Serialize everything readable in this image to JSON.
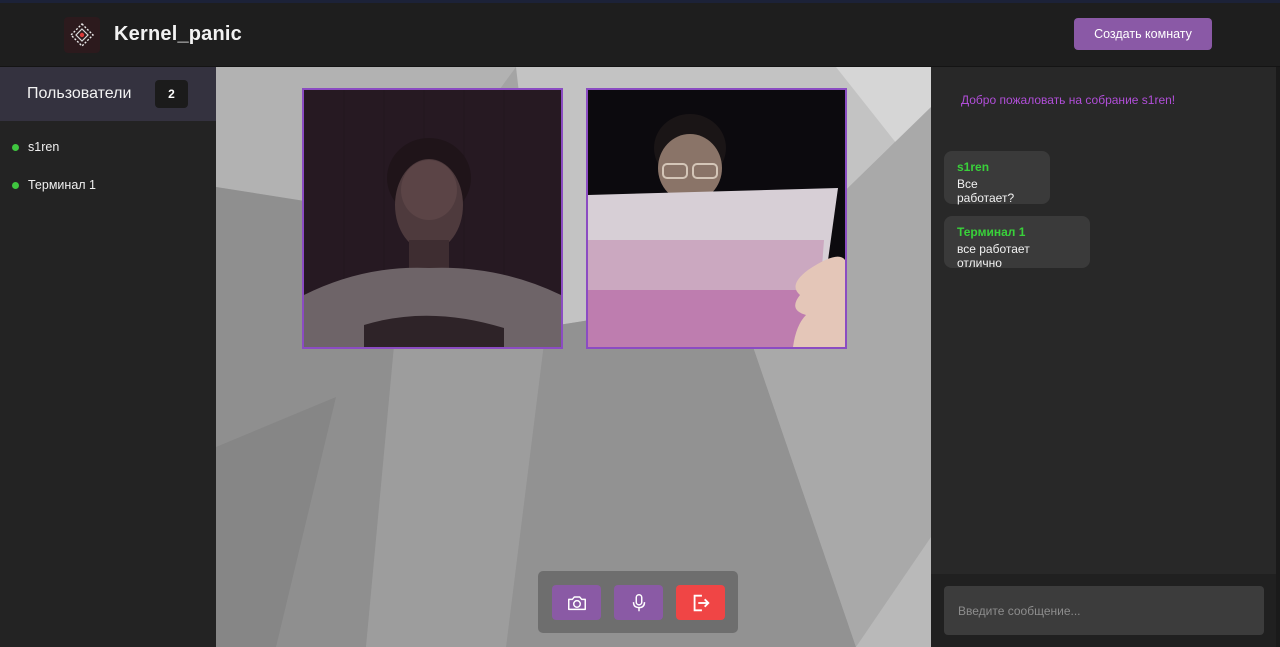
{
  "header": {
    "brand": "Kernel_panic",
    "create_room_label": "Создать комнату",
    "logo_icon": "diamond-logo-icon"
  },
  "sidebar": {
    "title": "Пользователи",
    "count": "2",
    "users": [
      {
        "name": "s1ren",
        "status": "online"
      },
      {
        "name": "Терминал 1",
        "status": "online"
      }
    ]
  },
  "stage": {
    "videos": [
      {
        "participant": "participant-1"
      },
      {
        "participant": "participant-2"
      }
    ],
    "controls": [
      {
        "name": "camera",
        "icon": "camera-icon"
      },
      {
        "name": "microphone",
        "icon": "microphone-icon"
      },
      {
        "name": "leave",
        "icon": "exit-icon"
      }
    ]
  },
  "chat": {
    "welcome": "Добро пожаловать на собрание s1ren!",
    "messages": [
      {
        "author": "s1ren",
        "text": "Все работает?"
      },
      {
        "author": "Терминал 1",
        "text": "все работает отлично"
      }
    ],
    "input_placeholder": "Введите сообщение..."
  },
  "colors": {
    "accent": "#8a59a6",
    "online": "#3fc53f",
    "author": "#39d13a",
    "welcome": "#b14ed9",
    "danger": "#f04545",
    "video_border": "#8b4cc2"
  }
}
